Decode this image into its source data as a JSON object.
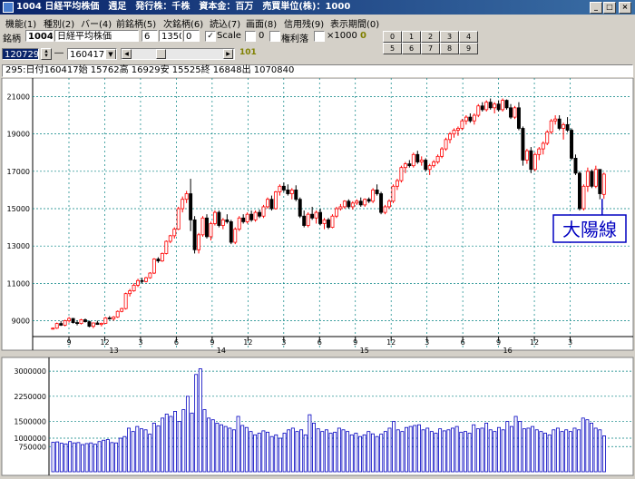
{
  "title": {
    "text": "1004 日経平均株価　週足　発行株：千株　資本金：百万　売買単位(株)：1000"
  },
  "menu": [
    "機能(1)",
    "種別(2)",
    "バー(4)",
    "前銘柄(5)",
    "次銘柄(6)",
    "読込(7)",
    "画面(8)",
    "信用残(9)",
    "表示期間(0)"
  ],
  "toolbar": {
    "code_label": "銘柄",
    "code": "1004",
    "name": "日経平均株価",
    "field_a": "6",
    "field_b": "1350",
    "field_c": "0",
    "scale_label": "Scale",
    "scale_value": "0",
    "kenri_label": "権利落",
    "x1000_label": "×1000",
    "x1000_value": "0",
    "date_from": "120729",
    "date_to": "160417",
    "bars_count": "101",
    "num_buttons": [
      "0",
      "1",
      "2",
      "3",
      "4",
      "5",
      "6",
      "7",
      "8",
      "9"
    ]
  },
  "info_line": "295:日付160417始 15762高 16929安 15525終 16848出 1070840",
  "annotation": {
    "label": "大陽線"
  },
  "colors": {
    "up": "#ff0000",
    "down": "#000000",
    "volume_fill": "#ffffff",
    "volume_stroke": "#0000c0",
    "grid": "#008080",
    "annot": "#0000c0"
  },
  "chart_data": [
    {
      "type": "candlestick",
      "title": "",
      "ylim": [
        8200,
        21800
      ],
      "yticks": [
        9000,
        11000,
        13000,
        15000,
        17000,
        19000,
        21000
      ],
      "xticks": [
        "9",
        "12",
        "3",
        "6",
        "9",
        "12",
        "3",
        "6",
        "9",
        "12",
        "3",
        "6",
        "9",
        "12",
        "3"
      ],
      "year_labels": [
        "13",
        "14",
        "15",
        "16"
      ],
      "grid": true,
      "ohlc": [
        [
          8570,
          8640,
          8520,
          8600
        ],
        [
          8600,
          8900,
          8560,
          8850
        ],
        [
          8850,
          8980,
          8720,
          8760
        ],
        [
          8760,
          9050,
          8700,
          9000
        ],
        [
          9000,
          9200,
          8900,
          9120
        ],
        [
          9120,
          9150,
          8850,
          8900
        ],
        [
          8900,
          9000,
          8750,
          8850
        ],
        [
          8850,
          9100,
          8800,
          9050
        ],
        [
          9050,
          9120,
          8900,
          8950
        ],
        [
          8950,
          9000,
          8650,
          8700
        ],
        [
          8700,
          8900,
          8600,
          8880
        ],
        [
          8880,
          9000,
          8780,
          8800
        ],
        [
          8800,
          8900,
          8700,
          8860
        ],
        [
          8860,
          9200,
          8840,
          9150
        ],
        [
          9150,
          9250,
          9050,
          9100
        ],
        [
          9100,
          9250,
          9000,
          9200
        ],
        [
          9200,
          9550,
          9150,
          9500
        ],
        [
          9500,
          9700,
          9450,
          9650
        ],
        [
          9650,
          10500,
          9600,
          10450
        ],
        [
          10450,
          10700,
          10300,
          10600
        ],
        [
          10600,
          11000,
          10550,
          10900
        ],
        [
          10900,
          11250,
          10800,
          11150
        ],
        [
          11150,
          11300,
          11000,
          11100
        ],
        [
          11100,
          11350,
          11050,
          11300
        ],
        [
          11300,
          11600,
          11250,
          11550
        ],
        [
          11550,
          12350,
          11500,
          12300
        ],
        [
          12300,
          12400,
          12100,
          12200
        ],
        [
          12200,
          12650,
          12150,
          12600
        ],
        [
          12600,
          13300,
          12550,
          13250
        ],
        [
          13250,
          13600,
          13150,
          13550
        ],
        [
          13550,
          14000,
          13400,
          13900
        ],
        [
          13900,
          15100,
          13850,
          15000
        ],
        [
          15000,
          15650,
          14800,
          15500
        ],
        [
          15500,
          15950,
          15300,
          15800
        ],
        [
          15800,
          16600,
          13800,
          14400
        ],
        [
          14400,
          14600,
          12600,
          12800
        ],
        [
          12800,
          13700,
          12600,
          13600
        ],
        [
          13600,
          14600,
          13500,
          14500
        ],
        [
          14500,
          14700,
          13400,
          13500
        ],
        [
          13500,
          14300,
          13300,
          14200
        ],
        [
          14200,
          14900,
          14100,
          14800
        ],
        [
          14800,
          14900,
          14000,
          14100
        ],
        [
          14100,
          14500,
          13900,
          14400
        ],
        [
          14400,
          14700,
          14200,
          14300
        ],
        [
          14300,
          14400,
          13100,
          13200
        ],
        [
          13200,
          14000,
          13100,
          13900
        ],
        [
          13900,
          14600,
          13800,
          14500
        ],
        [
          14500,
          14700,
          14200,
          14300
        ],
        [
          14300,
          14800,
          14200,
          14700
        ],
        [
          14700,
          14900,
          14300,
          14400
        ],
        [
          14400,
          14900,
          14300,
          14800
        ],
        [
          14800,
          14950,
          14500,
          14600
        ],
        [
          14600,
          15200,
          14500,
          15100
        ],
        [
          15100,
          15600,
          15000,
          15500
        ],
        [
          15500,
          15700,
          14900,
          15000
        ],
        [
          15000,
          15950,
          14950,
          15900
        ],
        [
          15900,
          16300,
          15700,
          16200
        ],
        [
          16200,
          16400,
          15900,
          16000
        ],
        [
          16000,
          16300,
          15700,
          15800
        ],
        [
          15800,
          16100,
          15500,
          16000
        ],
        [
          16000,
          16250,
          15400,
          15500
        ],
        [
          15500,
          15600,
          14500,
          14600
        ],
        [
          14600,
          14900,
          14000,
          14100
        ],
        [
          14100,
          14800,
          14000,
          14700
        ],
        [
          14700,
          15100,
          14400,
          14500
        ],
        [
          14500,
          14900,
          14200,
          14800
        ],
        [
          14800,
          15000,
          14100,
          14200
        ],
        [
          14200,
          14500,
          13900,
          14400
        ],
        [
          14400,
          14500,
          13900,
          14000
        ],
        [
          14000,
          14700,
          13950,
          14600
        ],
        [
          14600,
          15100,
          14500,
          15000
        ],
        [
          15000,
          15250,
          14900,
          15100
        ],
        [
          15100,
          15450,
          15000,
          15400
        ],
        [
          15400,
          15500,
          15000,
          15100
        ],
        [
          15100,
          15400,
          14950,
          15300
        ],
        [
          15300,
          15500,
          15200,
          15400
        ],
        [
          15400,
          15600,
          15100,
          15200
        ],
        [
          15200,
          15550,
          15100,
          15500
        ],
        [
          15500,
          15600,
          15300,
          15400
        ],
        [
          15400,
          16100,
          15300,
          16000
        ],
        [
          16000,
          16300,
          15700,
          15800
        ],
        [
          15800,
          15900,
          14700,
          14800
        ],
        [
          14800,
          15200,
          14700,
          15100
        ],
        [
          15100,
          15500,
          15000,
          15400
        ],
        [
          15400,
          16300,
          15300,
          16200
        ],
        [
          16200,
          16600,
          16000,
          16500
        ],
        [
          16500,
          17300,
          16400,
          17200
        ],
        [
          17200,
          17500,
          16900,
          17400
        ],
        [
          17400,
          17600,
          17200,
          17300
        ],
        [
          17300,
          18000,
          17200,
          17900
        ],
        [
          17900,
          18100,
          17400,
          17500
        ],
        [
          17500,
          17800,
          17300,
          17600
        ],
        [
          17600,
          17700,
          17000,
          17100
        ],
        [
          17100,
          17400,
          16800,
          17300
        ],
        [
          17300,
          17600,
          17200,
          17500
        ],
        [
          17500,
          17900,
          17400,
          17800
        ],
        [
          17800,
          18300,
          17700,
          18200
        ],
        [
          18200,
          18800,
          18100,
          18700
        ],
        [
          18700,
          19100,
          18500,
          19000
        ],
        [
          19000,
          19300,
          18800,
          19200
        ],
        [
          19200,
          19400,
          18900,
          19300
        ],
        [
          19300,
          19800,
          19200,
          19700
        ],
        [
          19700,
          20000,
          19500,
          19900
        ],
        [
          19900,
          20100,
          19600,
          19700
        ],
        [
          19700,
          20100,
          19500,
          20000
        ],
        [
          20000,
          20600,
          19900,
          20500
        ],
        [
          20500,
          20700,
          20200,
          20300
        ],
        [
          20300,
          20800,
          20200,
          20700
        ],
        [
          20700,
          20900,
          20300,
          20400
        ],
        [
          20400,
          20700,
          20100,
          20600
        ],
        [
          20600,
          20800,
          20200,
          20300
        ],
        [
          20300,
          20900,
          20200,
          20800
        ],
        [
          20800,
          20850,
          20300,
          20400
        ],
        [
          20400,
          20600,
          19800,
          19900
        ],
        [
          19900,
          20500,
          19800,
          20400
        ],
        [
          20400,
          20700,
          19200,
          19300
        ],
        [
          19300,
          19400,
          17300,
          17600
        ],
        [
          17600,
          18200,
          17400,
          18100
        ],
        [
          18100,
          18300,
          16900,
          17100
        ],
        [
          17100,
          18000,
          17000,
          17900
        ],
        [
          17900,
          18300,
          17600,
          18200
        ],
        [
          18200,
          18600,
          17900,
          18500
        ],
        [
          18500,
          19200,
          18400,
          19100
        ],
        [
          19100,
          19800,
          19000,
          19700
        ],
        [
          19700,
          20000,
          19500,
          19800
        ],
        [
          19800,
          20000,
          19200,
          19300
        ],
        [
          19300,
          19600,
          18700,
          19500
        ],
        [
          19500,
          19900,
          19100,
          19200
        ],
        [
          19200,
          19300,
          17600,
          17700
        ],
        [
          17700,
          17900,
          16800,
          16900
        ],
        [
          16900,
          17000,
          14900,
          15000
        ],
        [
          15000,
          16300,
          14900,
          16200
        ],
        [
          16200,
          17200,
          15900,
          17000
        ],
        [
          17000,
          17100,
          16100,
          16200
        ],
        [
          16200,
          17300,
          16100,
          17100
        ],
        [
          17100,
          17100,
          15500,
          15800
        ],
        [
          15762,
          16929,
          15525,
          16848
        ]
      ]
    },
    {
      "type": "bar",
      "title": "",
      "ylim": [
        0,
        3300000
      ],
      "yticks": [
        750000,
        1000000,
        1500000,
        2250000,
        3000000
      ],
      "values": [
        880000,
        890000,
        850000,
        830000,
        900000,
        860000,
        870000,
        810000,
        840000,
        860000,
        820000,
        900000,
        940000,
        960000,
        870000,
        860000,
        1000000,
        1050000,
        1300000,
        1200000,
        1350000,
        1280000,
        1250000,
        1120000,
        1450000,
        1370000,
        1600000,
        1720000,
        1650000,
        1800000,
        1500000,
        1850000,
        2250000,
        1750000,
        2900000,
        3070000,
        1850000,
        1600000,
        1550000,
        1450000,
        1400000,
        1350000,
        1300000,
        1250000,
        1650000,
        1380000,
        1320000,
        1200000,
        1100000,
        1150000,
        1220000,
        1180000,
        1050000,
        1100000,
        1000000,
        1150000,
        1250000,
        1300000,
        1200000,
        1250000,
        1100000,
        1700000,
        1450000,
        1280000,
        1200000,
        1250000,
        1150000,
        1180000,
        1300000,
        1250000,
        1200000,
        1100000,
        1150000,
        1050000,
        1100000,
        1200000,
        1130000,
        1050000,
        1120000,
        1200000,
        1300000,
        1500000,
        1250000,
        1200000,
        1320000,
        1350000,
        1380000,
        1400000,
        1250000,
        1300000,
        1200000,
        1150000,
        1280000,
        1220000,
        1250000,
        1300000,
        1350000,
        1180000,
        1200000,
        1150000,
        1400000,
        1280000,
        1300000,
        1450000,
        1250000,
        1200000,
        1320000,
        1250000,
        1500000,
        1350000,
        1650000,
        1500000,
        1280000,
        1300000,
        1350000,
        1250000,
        1200000,
        1150000,
        1100000,
        1250000,
        1300000,
        1200000,
        1250000,
        1200000,
        1300000,
        1250000,
        1600000,
        1550000,
        1450000,
        1300000,
        1250000,
        1070840
      ]
    }
  ]
}
